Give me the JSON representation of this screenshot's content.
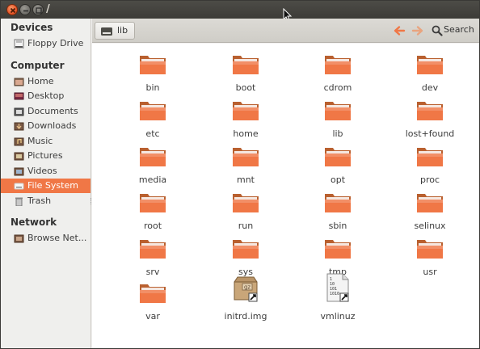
{
  "window": {
    "title": "/"
  },
  "sidebar": {
    "sections": [
      {
        "label": "Devices",
        "items": [
          {
            "label": "Floppy Drive",
            "icon": "floppy-icon"
          }
        ]
      },
      {
        "label": "Computer",
        "items": [
          {
            "label": "Home",
            "icon": "home-folder-icon"
          },
          {
            "label": "Desktop",
            "icon": "desktop-icon"
          },
          {
            "label": "Documents",
            "icon": "documents-icon"
          },
          {
            "label": "Downloads",
            "icon": "downloads-icon"
          },
          {
            "label": "Music",
            "icon": "music-icon"
          },
          {
            "label": "Pictures",
            "icon": "pictures-icon"
          },
          {
            "label": "Videos",
            "icon": "videos-icon"
          },
          {
            "label": "File System",
            "icon": "drive-icon",
            "active": true
          },
          {
            "label": "Trash",
            "icon": "trash-icon"
          }
        ]
      },
      {
        "label": "Network",
        "items": [
          {
            "label": "Browse Net...",
            "icon": "network-icon"
          }
        ]
      }
    ]
  },
  "toolbar": {
    "breadcrumb": "lib",
    "search_label": "Search",
    "back_color": "#f07746",
    "forward_color": "#e9a47f"
  },
  "content": {
    "folder_color": "#f07746",
    "items": [
      {
        "label": "bin",
        "type": "folder"
      },
      {
        "label": "boot",
        "type": "folder"
      },
      {
        "label": "cdrom",
        "type": "folder"
      },
      {
        "label": "dev",
        "type": "folder"
      },
      {
        "label": "etc",
        "type": "folder"
      },
      {
        "label": "home",
        "type": "folder"
      },
      {
        "label": "lib",
        "type": "folder"
      },
      {
        "label": "lost+found",
        "type": "folder"
      },
      {
        "label": "media",
        "type": "folder"
      },
      {
        "label": "mnt",
        "type": "folder"
      },
      {
        "label": "opt",
        "type": "folder"
      },
      {
        "label": "proc",
        "type": "folder"
      },
      {
        "label": "root",
        "type": "folder"
      },
      {
        "label": "run",
        "type": "folder"
      },
      {
        "label": "sbin",
        "type": "folder"
      },
      {
        "label": "selinux",
        "type": "folder"
      },
      {
        "label": "srv",
        "type": "folder"
      },
      {
        "label": "sys",
        "type": "folder"
      },
      {
        "label": "tmp",
        "type": "folder"
      },
      {
        "label": "usr",
        "type": "folder"
      },
      {
        "label": "var",
        "type": "folder"
      },
      {
        "label": "initrd.img",
        "type": "archive-link",
        "badge": "gz"
      },
      {
        "label": "vmlinuz",
        "type": "binary-link",
        "badge_lines": [
          "1",
          "10",
          "101",
          "1010"
        ]
      }
    ]
  }
}
